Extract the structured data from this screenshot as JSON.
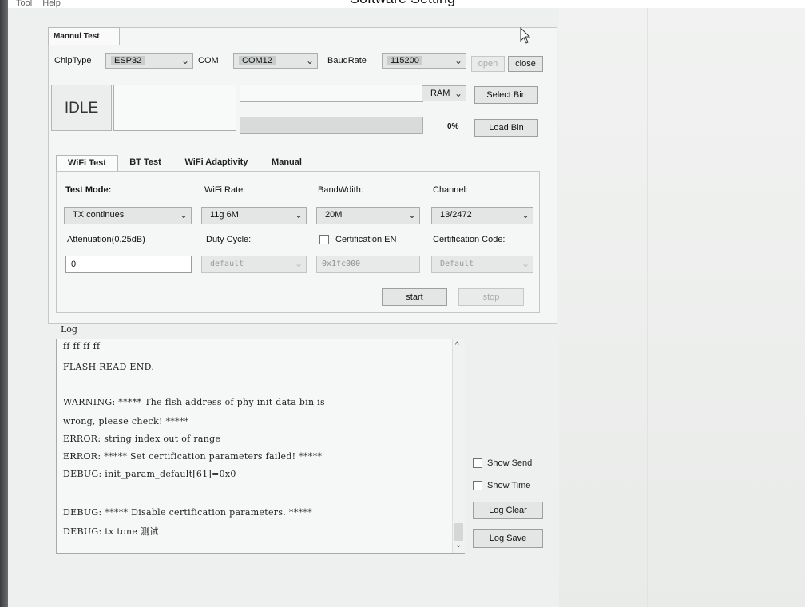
{
  "window": {
    "title": "Software Setting",
    "menu": [
      "Tool",
      "Help"
    ]
  },
  "top_tab": "Mannul Test",
  "config": {
    "chiptype_label": "ChipType",
    "chiptype_value": "ESP32",
    "com_label": "COM",
    "com_value": "COM12",
    "baudrate_label": "BaudRate",
    "baudrate_value": "115200",
    "open_label": "open",
    "close_label": "close"
  },
  "bin": {
    "status": "IDLE",
    "memory_value": "RAM",
    "select_label": "Select Bin",
    "progress_text": "0%",
    "progress_value": 0,
    "load_label": "Load Bin"
  },
  "tabs": [
    "WiFi Test",
    "BT Test",
    "WiFi Adaptivity",
    "Manual"
  ],
  "wifi": {
    "test_mode_label": "Test Mode:",
    "test_mode_value": "TX continues",
    "rate_label": "WiFi Rate:",
    "rate_value": "11g 6M",
    "bandwidth_label": "BandWdith:",
    "bandwidth_value": "20M",
    "channel_label": "Channel:",
    "channel_value": "13/2472",
    "attenuation_label": "Attenuation(0.25dB)",
    "attenuation_value": "0",
    "duty_label": "Duty Cycle:",
    "duty_value": "default",
    "cert_en_label": "Certification EN",
    "cert_addr_value": "0x1fc000",
    "cert_code_label": "Certification Code:",
    "cert_code_value": "Default",
    "start_label": "start",
    "stop_label": "stop"
  },
  "log": {
    "label": "Log",
    "lines": [
      "ff ff ff ff",
      "FLASH READ END.",
      "",
      "WARNING: ***** The flsh address of phy init data bin is",
      "wrong, please check! *****",
      "ERROR: string index out of range",
      "ERROR: ***** Set certification parameters failed! *****",
      "DEBUG: init_param_default[61]=0x0",
      "",
      "DEBUG: ***** Disable certification parameters. *****",
      "DEBUG: tx tone 测试"
    ],
    "show_send_label": "Show Send",
    "show_time_label": "Show Time",
    "clear_label": "Log Clear",
    "save_label": "Log Save"
  },
  "icons": {
    "dropdown": "chevron-down-icon",
    "scroll_up": "scroll-up-arrow-icon",
    "scroll_down": "scroll-down-arrow-icon",
    "cursor": "mouse-cursor-icon"
  }
}
